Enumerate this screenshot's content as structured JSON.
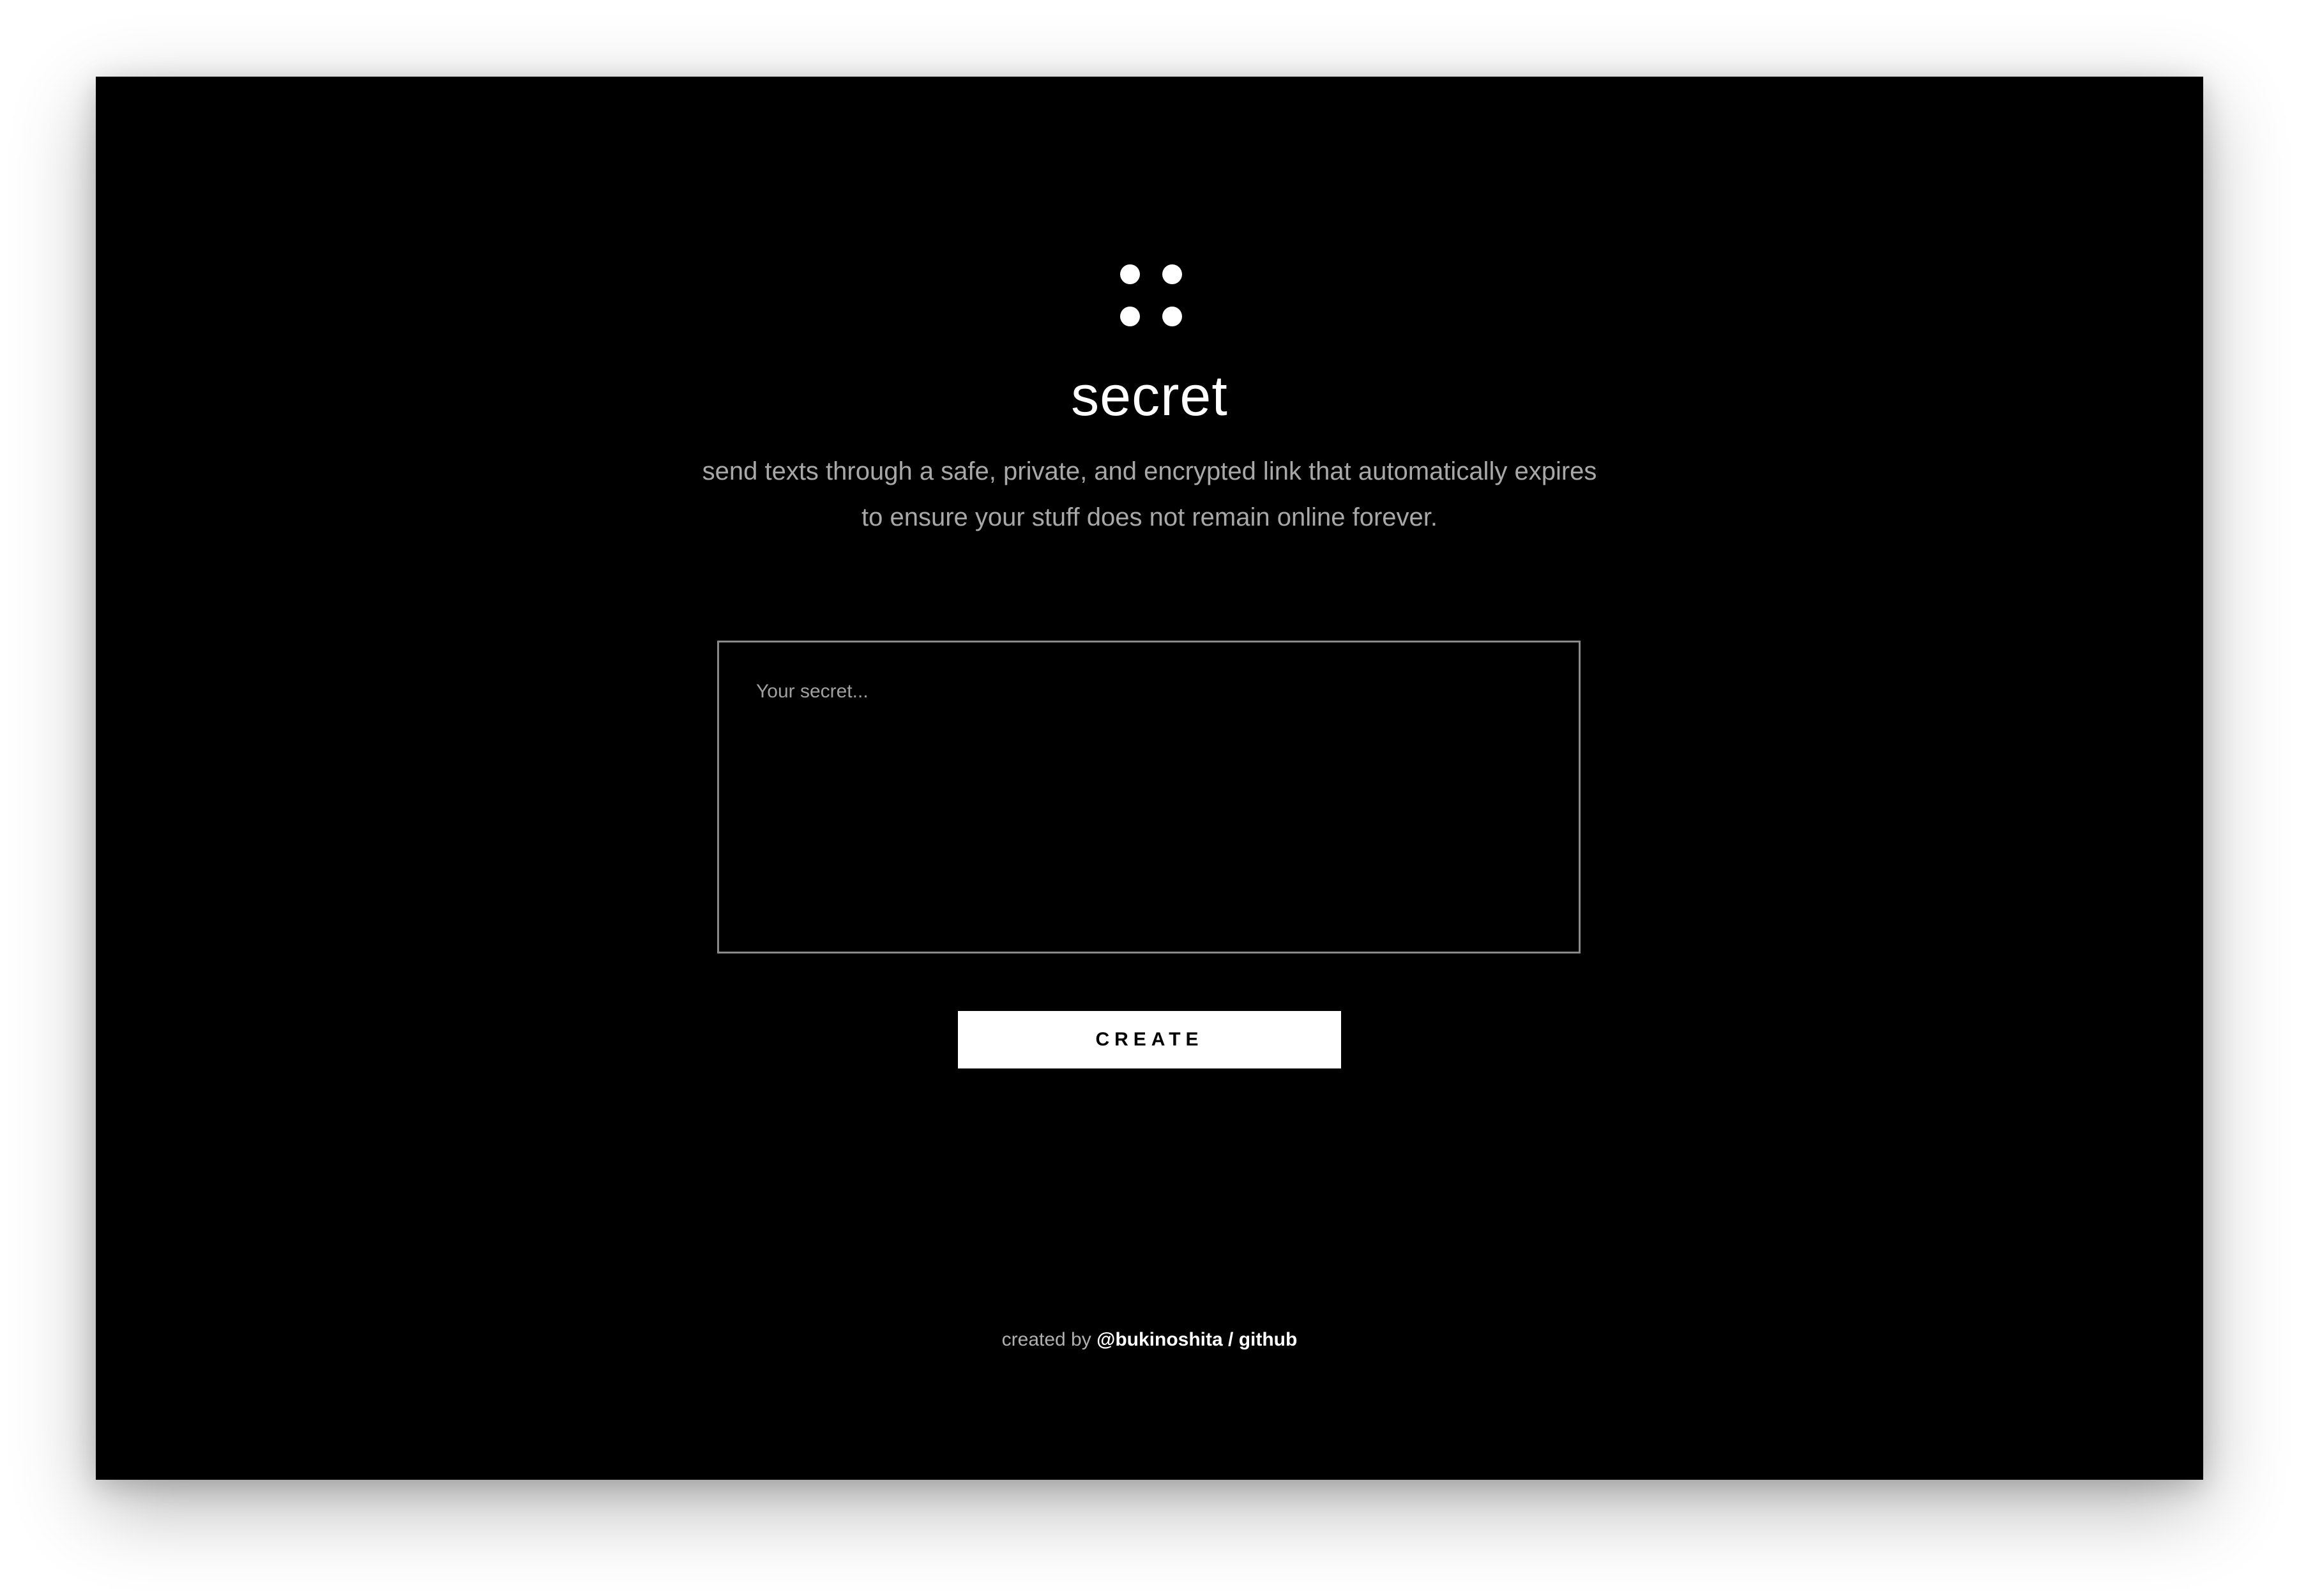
{
  "app": {
    "title": "secret",
    "tagline_line1": "send texts through a safe, private, and encrypted link that automatically expires",
    "tagline_line2": "to ensure your stuff does not remain online forever."
  },
  "form": {
    "secret_placeholder": "Your secret...",
    "secret_value": "",
    "create_label": "CREATE"
  },
  "footer": {
    "prefix": "created by",
    "author_link": "@bukinoshita",
    "separator": "/",
    "github_link": "github"
  },
  "colors": {
    "background": "#000000",
    "text": "#ffffff",
    "muted": "#a8a8a8",
    "border": "#8a8a8a"
  },
  "icons": {
    "logo": "four-dots-icon"
  }
}
